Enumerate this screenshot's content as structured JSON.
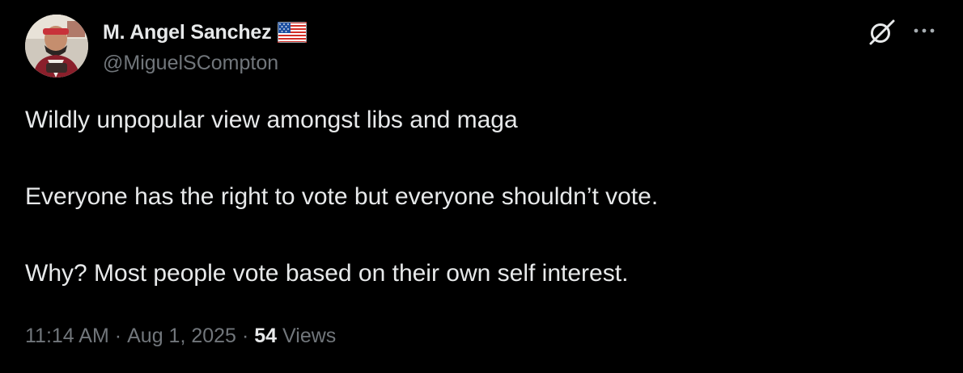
{
  "post": {
    "author": {
      "display_name": "M. Angel Sanchez",
      "handle": "@MiguelSCompton",
      "flag_icon": "us-flag-icon",
      "avatar_icon": "profile-photo"
    },
    "paragraphs": [
      "Wildly unpopular view amongst libs and maga",
      "Everyone has the right to vote but everyone shouldn’t vote.",
      "Why? Most people vote based on their own self interest."
    ],
    "time": "11:14 AM",
    "separator": "·",
    "date": "Aug 1, 2025",
    "views_count": "54",
    "views_label": "Views"
  },
  "actions": {
    "grok_icon": "grok-icon",
    "more_icon": "more-options-icon"
  },
  "colors": {
    "background": "#000000",
    "primary_text": "#e7e9ea",
    "secondary_text": "#71767b"
  }
}
